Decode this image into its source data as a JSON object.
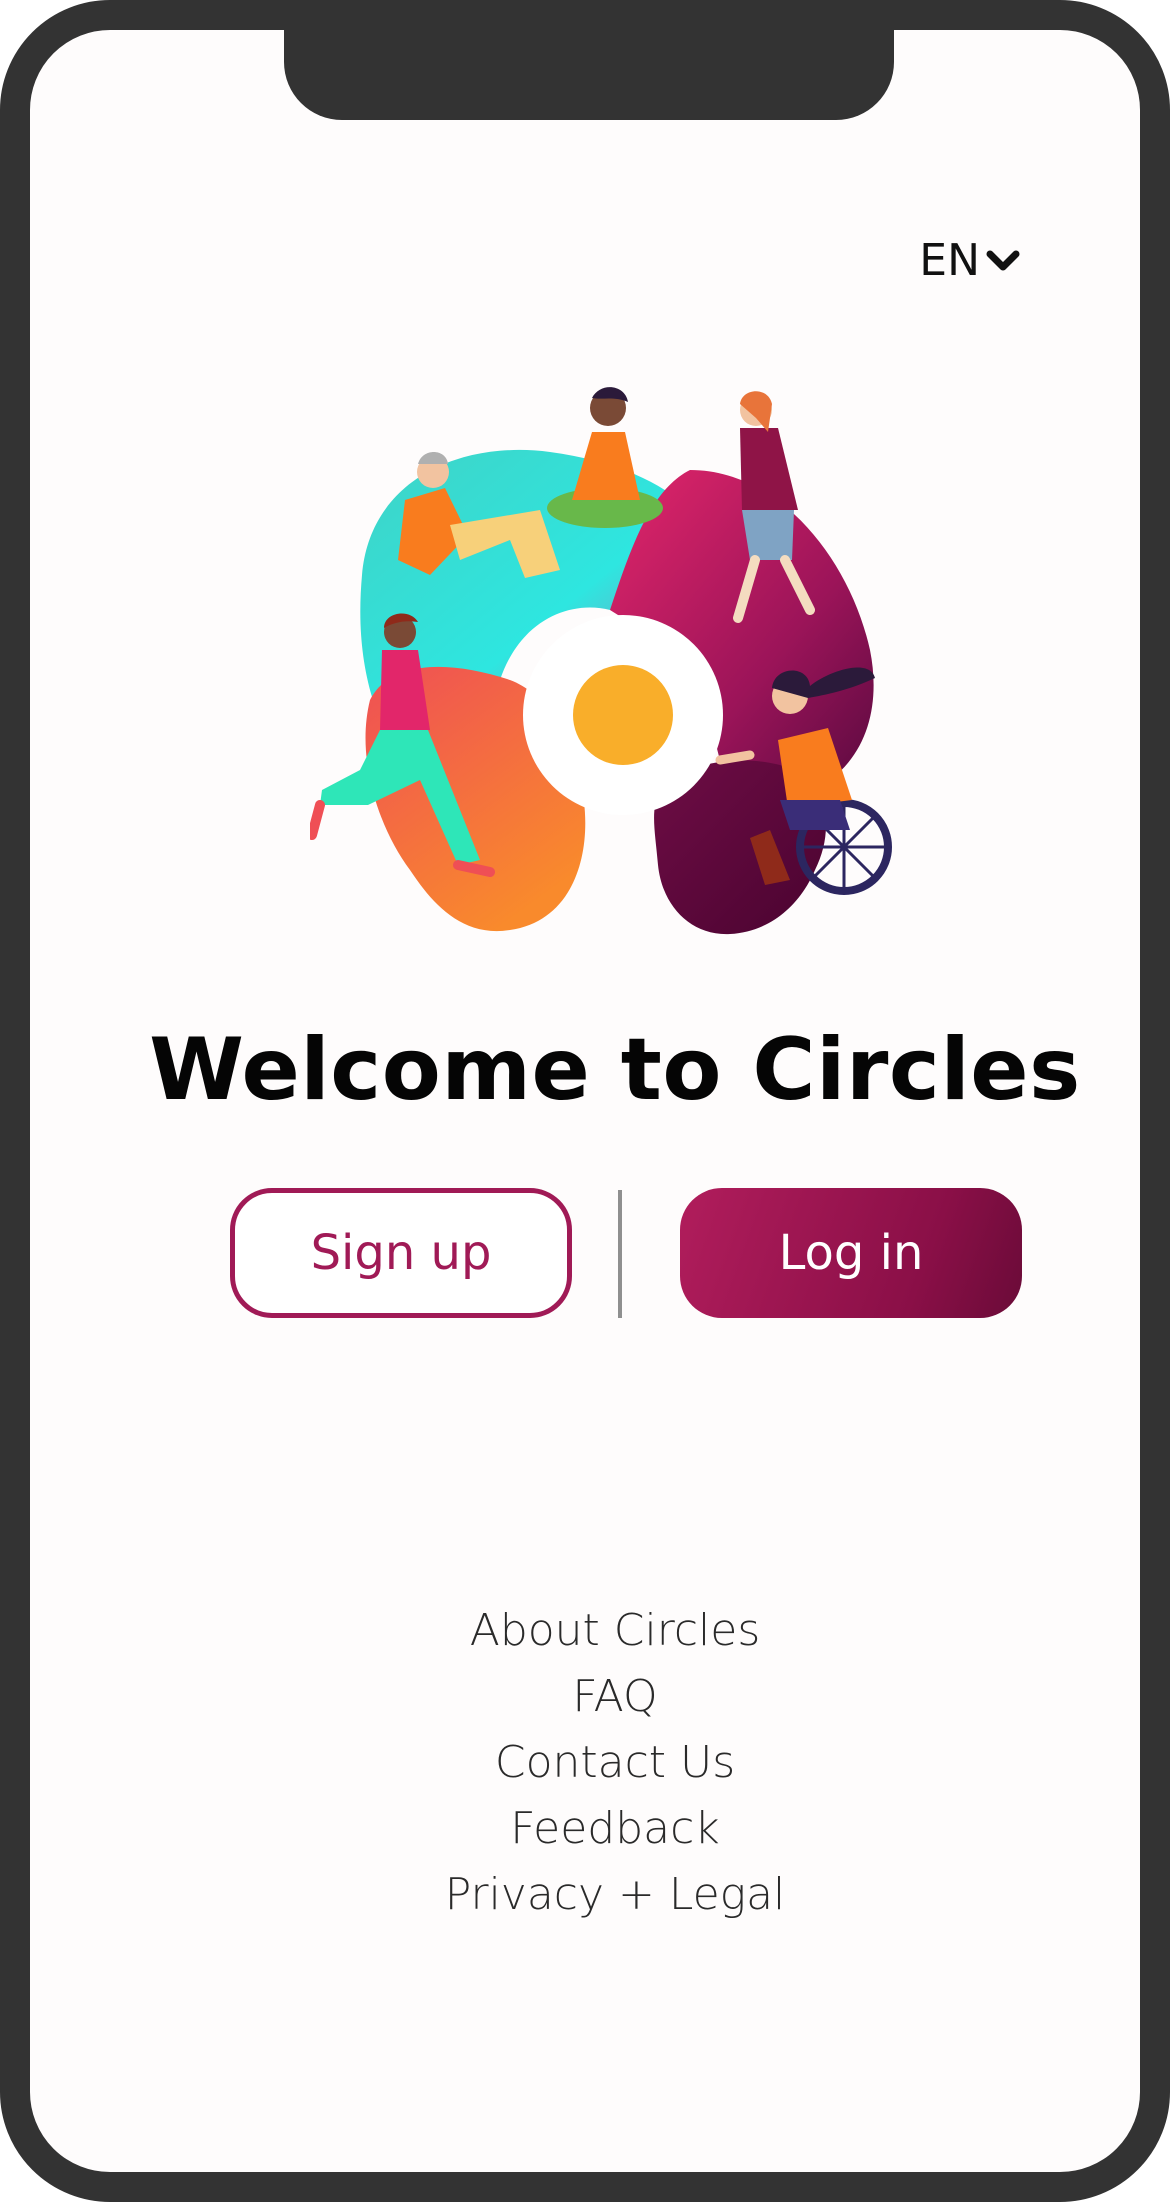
{
  "language": {
    "selected": "EN",
    "icon": "chevron-down-icon"
  },
  "illustration": {
    "description_icon": "circles-logo-illustration"
  },
  "welcome": {
    "title": "Welcome to Circles"
  },
  "actions": {
    "signup_label": "Sign up",
    "login_label": "Log in"
  },
  "footer": {
    "links": [
      "About Circles",
      "FAQ",
      "Contact Us",
      "Feedback",
      "Privacy + Legal"
    ]
  },
  "colors": {
    "brand": "#a01a56",
    "login_gradient_start": "#b11d5c",
    "login_gradient_end": "#6a0b38",
    "frame": "#333333"
  }
}
